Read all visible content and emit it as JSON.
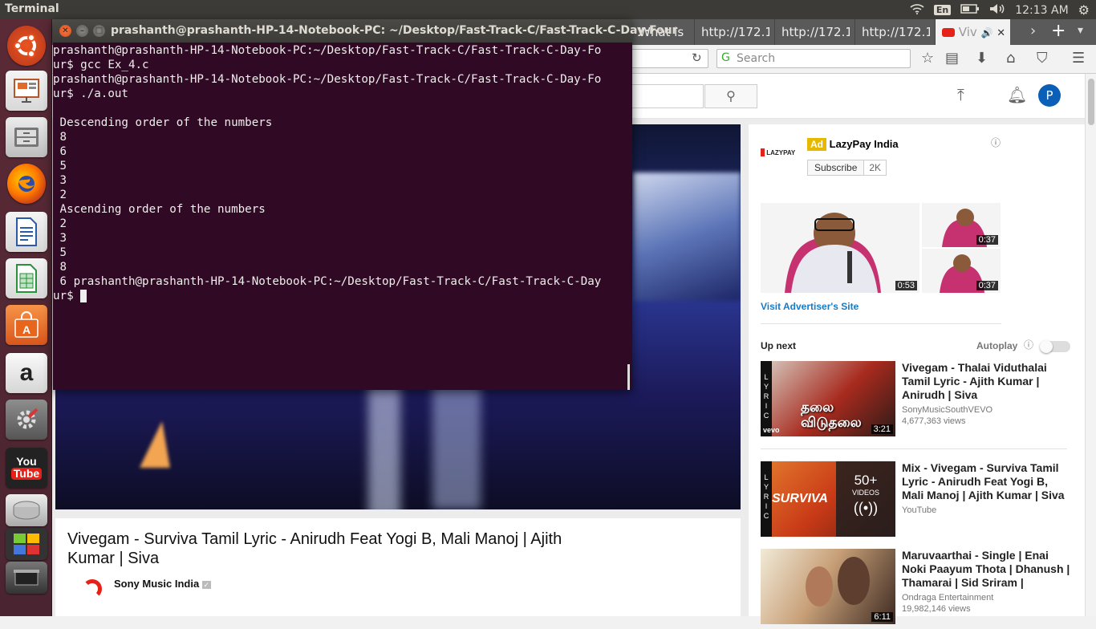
{
  "topbar": {
    "app_title": "Terminal",
    "keyboard_layout": "En",
    "clock": "12:13 AM"
  },
  "browser": {
    "tabs": [
      "What is t",
      "http://172.1",
      "http://172.1",
      "http://172.1",
      "Viv"
    ],
    "search_placeholder": "Search",
    "avatar_letter": "P"
  },
  "video": {
    "title": "Vivegam - Surviva Tamil Lyric - Anirudh Feat Yogi B, Mali Manoj | Ajith Kumar | Siva",
    "channel": "Sony Music India"
  },
  "ad": {
    "badge": "Ad",
    "advertiser": "LazyPay India",
    "logo_text": "LAZYPAY",
    "subscribe_label": "Subscribe",
    "subscriber_count": "2K",
    "durations": [
      "0:53",
      "0:37",
      "0:37"
    ],
    "visit_link": "Visit Advertiser's Site"
  },
  "upnext": {
    "heading": "Up next",
    "autoplay_label": "Autoplay",
    "items": [
      {
        "title": "Vivegam - Thalai Viduthalai Tamil Lyric - Ajith Kumar | Anirudh | Siva",
        "channel": "SonyMusicSouthVEVO",
        "views": "4,677,363 views",
        "duration": "3:21",
        "overlay": "தலை விடுதலை"
      },
      {
        "title": "Mix - Vivegam - Surviva Tamil Lyric - Anirudh Feat Yogi B, Mali Manoj | Ajith Kumar | Siva",
        "channel": "YouTube",
        "views": "",
        "duration": "",
        "overlay": "SURVIVA",
        "playlist_count": "50+",
        "playlist_label": "VIDEOS"
      },
      {
        "title": "Maruvaarthai - Single | Enai Noki Paayum Thota | Dhanush | Thamarai | Sid Sriram |",
        "channel": "Ondraga Entertainment",
        "views": "19,982,146 views",
        "duration": "6:11",
        "overlay": ""
      }
    ]
  },
  "terminal": {
    "window_title": "prashanth@prashanth-HP-14-Notebook-PC: ~/Desktop/Fast-Track-C/Fast-Track-C-Day-Four",
    "lines": [
      "prashanth@prashanth-HP-14-Notebook-PC:~/Desktop/Fast-Track-C/Fast-Track-C-Day-Fo",
      "ur$ gcc Ex_4.c",
      "prashanth@prashanth-HP-14-Notebook-PC:~/Desktop/Fast-Track-C/Fast-Track-C-Day-Fo",
      "ur$ ./a.out",
      "",
      " Descending order of the numbers",
      " 8",
      " 6",
      " 5",
      " 3",
      " 2",
      " Ascending order of the numbers",
      " 2",
      " 3",
      " 5",
      " 8",
      " 6 prashanth@prashanth-HP-14-Notebook-PC:~/Desktop/Fast-Track-C/Fast-Track-C-Day",
      "ur$ "
    ]
  },
  "launcher": [
    "Ubuntu",
    "Impress",
    "Files",
    "Firefox",
    "Writer",
    "Calc",
    "Software Center",
    "Amazon",
    "System Settings",
    "YouTube",
    "Disks",
    "Workspaces",
    "Trash"
  ],
  "colors": {
    "terminal_bg": "#300a24",
    "launcher_bg": "#4a2531",
    "yt_red": "#e62117",
    "link_blue": "#167ac6"
  }
}
